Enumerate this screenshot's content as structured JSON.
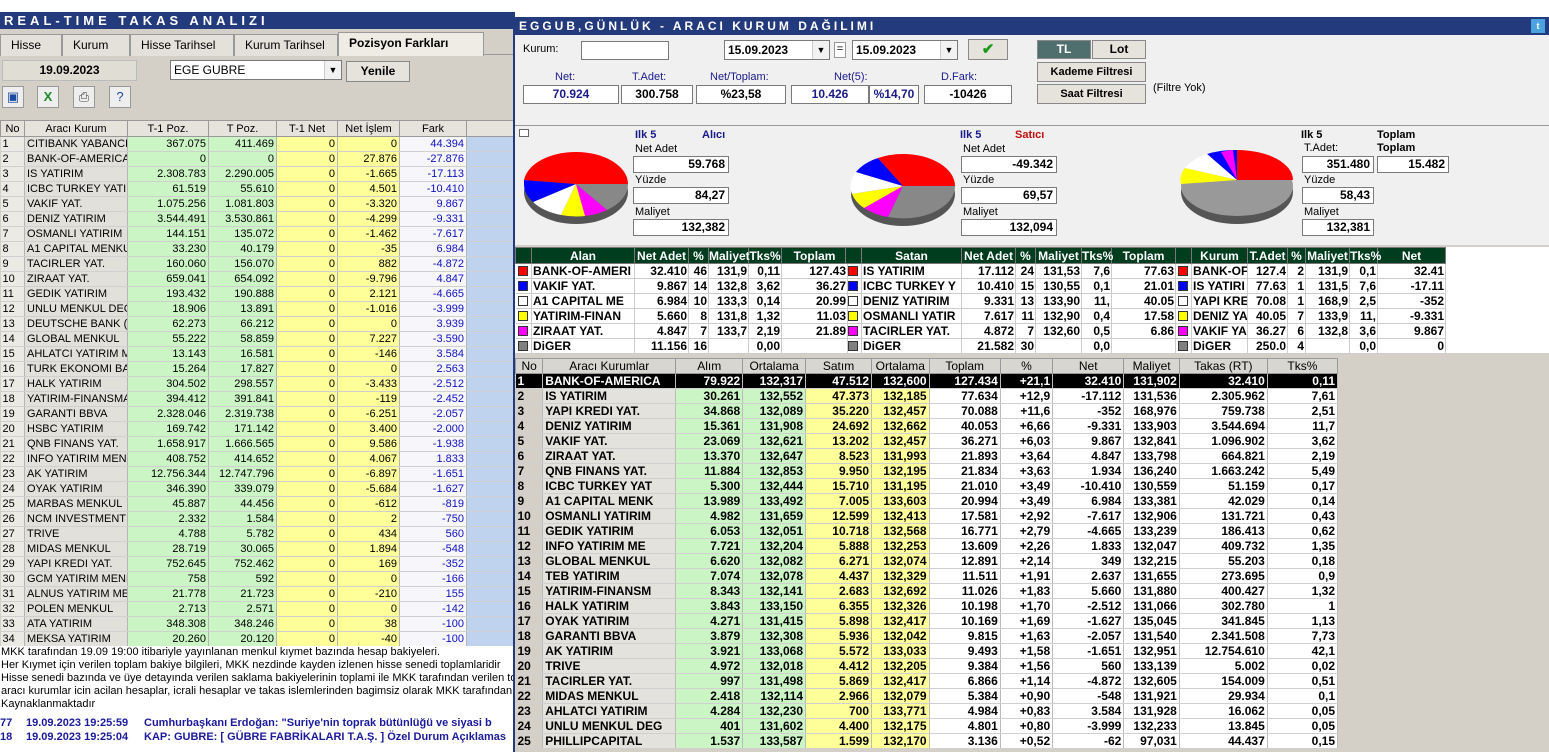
{
  "left": {
    "title": "REAL-TIME TAKAS ANALIZI",
    "tabs": [
      "Hisse",
      "Kurum",
      "Hisse Tarihsel",
      "Kurum Tarihsel",
      "Pozisyon Farkları"
    ],
    "date": "19.09.2023",
    "stock": "EGE GUBRE",
    "refresh": "Yenile",
    "columns": [
      "No",
      "Aracı Kurum",
      "T-1 Poz.",
      "T Poz.",
      "T-1 Net",
      "Net İşlem",
      "Fark"
    ],
    "rows": [
      [
        "1",
        "CITIBANK YABANCI",
        "367.075",
        "411.469",
        "0",
        "0",
        "44.394"
      ],
      [
        "2",
        "BANK-OF-AMERICA",
        "0",
        "0",
        "0",
        "27.876",
        "-27.876"
      ],
      [
        "3",
        "IS YATIRIM",
        "2.308.783",
        "2.290.005",
        "0",
        "-1.665",
        "-17.113"
      ],
      [
        "4",
        "ICBC TURKEY YATIR",
        "61.519",
        "55.610",
        "0",
        "4.501",
        "-10.410"
      ],
      [
        "5",
        "VAKIF YAT.",
        "1.075.256",
        "1.081.803",
        "0",
        "-3.320",
        "9.867"
      ],
      [
        "6",
        "DENIZ YATIRIM",
        "3.544.491",
        "3.530.861",
        "0",
        "-4.299",
        "-9.331"
      ],
      [
        "7",
        "OSMANLI YATIRIM",
        "144.151",
        "135.072",
        "0",
        "-1.462",
        "-7.617"
      ],
      [
        "8",
        "A1 CAPITAL MENKU",
        "33.230",
        "40.179",
        "0",
        "-35",
        "6.984"
      ],
      [
        "9",
        "TACIRLER YAT.",
        "160.060",
        "156.070",
        "0",
        "882",
        "-4.872"
      ],
      [
        "10",
        "ZIRAAT YAT.",
        "659.041",
        "654.092",
        "0",
        "-9.796",
        "4.847"
      ],
      [
        "11",
        "GEDIK YATIRIM",
        "193.432",
        "190.888",
        "0",
        "2.121",
        "-4.665"
      ],
      [
        "12",
        "UNLU MENKUL DEGE",
        "18.906",
        "13.891",
        "0",
        "-1.016",
        "-3.999"
      ],
      [
        "13",
        "DEUTSCHE BANK (Y",
        "62.273",
        "66.212",
        "0",
        "0",
        "3.939"
      ],
      [
        "14",
        "GLOBAL MENKUL",
        "55.222",
        "58.859",
        "0",
        "7.227",
        "-3.590"
      ],
      [
        "15",
        "AHLATCI YATIRIM M",
        "13.143",
        "16.581",
        "0",
        "-146",
        "3.584"
      ],
      [
        "16",
        "TURK EKONOMI BAN",
        "15.264",
        "17.827",
        "0",
        "0",
        "2.563"
      ],
      [
        "17",
        "HALK YATIRIM",
        "304.502",
        "298.557",
        "0",
        "-3.433",
        "-2.512"
      ],
      [
        "18",
        "YATIRIM-FINANSMA",
        "394.412",
        "391.841",
        "0",
        "-119",
        "-2.452"
      ],
      [
        "19",
        "GARANTI BBVA",
        "2.328.046",
        "2.319.738",
        "0",
        "-6.251",
        "-2.057"
      ],
      [
        "20",
        "HSBC YATIRIM",
        "169.742",
        "171.142",
        "0",
        "3.400",
        "-2.000"
      ],
      [
        "21",
        "QNB FINANS YAT.",
        "1.658.917",
        "1.666.565",
        "0",
        "9.586",
        "-1.938"
      ],
      [
        "22",
        "INFO YATIRIM MEN",
        "408.752",
        "414.652",
        "0",
        "4.067",
        "1.833"
      ],
      [
        "23",
        "AK YATIRIM",
        "12.756.344",
        "12.747.796",
        "0",
        "-6.897",
        "-1.651"
      ],
      [
        "24",
        "OYAK YATIRIM",
        "346.390",
        "339.079",
        "0",
        "-5.684",
        "-1.627"
      ],
      [
        "25",
        "MARBAS MENKUL",
        "45.887",
        "44.456",
        "0",
        "-612",
        "-819"
      ],
      [
        "26",
        "NCM INVESTMENT",
        "2.332",
        "1.584",
        "0",
        "2",
        "-750"
      ],
      [
        "27",
        "TRIVE",
        "4.788",
        "5.782",
        "0",
        "434",
        "560"
      ],
      [
        "28",
        "MIDAS MENKUL",
        "28.719",
        "30.065",
        "0",
        "1.894",
        "-548"
      ],
      [
        "29",
        "YAPI KREDI YAT.",
        "752.645",
        "752.462",
        "0",
        "169",
        "-352"
      ],
      [
        "30",
        "GCM YATIRIM MENK",
        "758",
        "592",
        "0",
        "0",
        "-166"
      ],
      [
        "31",
        "ALNUS YATIRIM ME",
        "21.778",
        "21.723",
        "0",
        "-210",
        "155"
      ],
      [
        "32",
        "POLEN MENKUL",
        "2.713",
        "2.571",
        "0",
        "0",
        "-142"
      ],
      [
        "33",
        "ATA YATIRIM",
        "348.308",
        "348.246",
        "0",
        "38",
        "-100"
      ],
      [
        "34",
        "MEKSA YATIRIM",
        "20.260",
        "20.120",
        "0",
        "-40",
        "-100"
      ]
    ],
    "notes": [
      "MKK tarafından 19.09 19:00 itibariyle yayınlanan menkul kıymet bazında hesap bakiyeleri.",
      "Her Kıymet için verilen toplam bakiye bilgileri, MKK nezdinde kayden izlenen hisse senedi toplamlaridir",
      "Hisse senedi bazında ve üye detayında verilen saklama bakiyelerinin toplami ile MKK tarafından verilen toplan",
      "aracı kurumlar icin acilan hesaplar, icrali hesaplar ve takas islemlerinden bagimsiz olarak MKK tarafından kulla",
      "Kaynaklanmaktadır"
    ],
    "news": [
      [
        "77",
        "19.09.2023 19:25:59",
        "Cumhurbaşkanı Erdoğan: \"Suriye'nin toprak bütünlüğü ve siyasi b"
      ],
      [
        "18",
        "19.09.2023 19:25:04",
        "KAP: GUBRE: [ GÜBRE FABRİKALARI T.A.Ş. ] Özel Durum Açıklamas"
      ]
    ]
  },
  "right": {
    "title": "EGGUB,GÜNLÜK - ARACI KURUM DAĞILIMI",
    "kurum_label": "Kurum:",
    "date_from": "15.09.2023",
    "equals": "=",
    "date_to": "15.09.2023",
    "tl": "TL",
    "lot": "Lot",
    "kademe": "Kademe Filtresi",
    "saat": "Saat Filtresi",
    "filtre_yok": "(Filtre Yok)",
    "stats_labels": [
      "Net:",
      "T.Adet:",
      "Net/Toplam:",
      "Net(5):",
      "D.Fark:"
    ],
    "stats": [
      "70.924",
      "300.758",
      "%23,58",
      "10.426",
      "%14,70",
      "-10426"
    ],
    "pie1": {
      "title": "Ilk 5",
      "side": "Alıcı",
      "net_label": "Net Adet",
      "net": "59.768",
      "yuzde_label": "Yüzde",
      "yuzde": "84,27",
      "maliyet_label": "Maliyet",
      "maliyet": "132,382"
    },
    "pie2": {
      "title": "Ilk 5",
      "side": "Satıcı",
      "net_label": "Net Adet",
      "net": "-49.342",
      "yuzde_label": "Yüzde",
      "yuzde": "69,57",
      "maliyet_label": "Maliyet",
      "maliyet": "132,094"
    },
    "pie3": {
      "title": "Ilk 5",
      "toplam1": "Toplam",
      "tadet_label": "T.Adet:",
      "toplam2": "Toplam",
      "tadet": "351.480",
      "toplam": "15.482",
      "yuzde_label": "Yüzde",
      "yuzde": "58,43",
      "maliyet_label": "Maliyet",
      "maliyet": "132,381"
    },
    "alan_cols": [
      "Alan",
      "Net Adet",
      "%",
      "Maliyet",
      "Tks%",
      "Toplam"
    ],
    "alan": [
      [
        "#ff0000",
        "BANK-OF-AMERI",
        "32.410",
        "46",
        "131,9",
        "0,11",
        "127.43"
      ],
      [
        "#0000ff",
        "VAKIF YAT.",
        "9.867",
        "14",
        "132,8",
        "3,62",
        "36.27"
      ],
      [
        "#ffffff",
        "A1 CAPITAL ME",
        "6.984",
        "10",
        "133,3",
        "0,14",
        "20.99"
      ],
      [
        "#ffff00",
        "YATIRIM-FINAN",
        "5.660",
        "8",
        "131,8",
        "1,32",
        "11.03"
      ],
      [
        "#ff00ff",
        "ZIRAAT YAT.",
        "4.847",
        "7",
        "133,7",
        "2,19",
        "21.89"
      ],
      [
        "#808080",
        "DiGER",
        "11.156",
        "16",
        "",
        "0,00",
        ""
      ]
    ],
    "satan_cols": [
      "Satan",
      "Net Adet",
      "%",
      "Maliyet",
      "Tks%",
      "Toplam"
    ],
    "satan": [
      [
        "#ff0000",
        "IS YATIRIM",
        "17.112",
        "24",
        "131,53",
        "7,6",
        "77.63"
      ],
      [
        "#0000ff",
        "ICBC TURKEY Y",
        "10.410",
        "15",
        "130,55",
        "0,1",
        "21.01"
      ],
      [
        "#ffffff",
        "DENIZ YATIRIM",
        "9.331",
        "13",
        "133,90",
        "11,",
        "40.05"
      ],
      [
        "#ffff00",
        "OSMANLI YATIR",
        "7.617",
        "11",
        "132,90",
        "0,4",
        "17.58"
      ],
      [
        "#ff00ff",
        "TACIRLER YAT.",
        "4.872",
        "7",
        "132,60",
        "0,5",
        "6.86"
      ],
      [
        "#808080",
        "DiGER",
        "21.582",
        "30",
        "",
        "0,0",
        ""
      ]
    ],
    "kurum_cols": [
      "Kurum",
      "T.Adet",
      "%",
      "Maliyet",
      "Tks%",
      "Net"
    ],
    "kurum": [
      [
        "#ff0000",
        "BANK-OF-",
        "127.4",
        "2",
        "131,9",
        "0,1",
        "32.41"
      ],
      [
        "#0000ff",
        "IS YATIRI",
        "77.63",
        "1",
        "131,5",
        "7,6",
        "-17.11"
      ],
      [
        "#ffffff",
        "YAPI KRE",
        "70.08",
        "1",
        "168,9",
        "2,5",
        "-352"
      ],
      [
        "#ffff00",
        "DENIZ YA",
        "40.05",
        "7",
        "133,9",
        "11,",
        "-9.331"
      ],
      [
        "#ff00ff",
        "VAKIF YA",
        "36.27",
        "6",
        "132,8",
        "3,6",
        "9.867"
      ],
      [
        "#808080",
        "DiGER",
        "250.0",
        "4",
        "",
        "0,0",
        "0"
      ]
    ],
    "big_cols": [
      "No",
      "Aracı Kurumlar",
      "Alım",
      "Ortalama",
      "Satım",
      "Ortalama",
      "Toplam",
      "%",
      "Net",
      "Maliyet",
      "Takas (RT)",
      "Tks%"
    ],
    "big": [
      [
        "1",
        "BANK-OF-AMERICA",
        "79.922",
        "132,317",
        "47.512",
        "132,600",
        "127.434",
        "+21,1",
        "32.410",
        "131,902",
        "32.410",
        "0,11"
      ],
      [
        "2",
        "IS YATIRIM",
        "30.261",
        "132,552",
        "47.373",
        "132,185",
        "77.634",
        "+12,9",
        "-17.112",
        "131,536",
        "2.305.962",
        "7,61"
      ],
      [
        "3",
        "YAPI KREDI YAT.",
        "34.868",
        "132,089",
        "35.220",
        "132,457",
        "70.088",
        "+11,6",
        "-352",
        "168,976",
        "759.738",
        "2,51"
      ],
      [
        "4",
        "DENIZ YATIRIM",
        "15.361",
        "131,908",
        "24.692",
        "132,662",
        "40.053",
        "+6,66",
        "-9.331",
        "133,903",
        "3.544.694",
        "11,7"
      ],
      [
        "5",
        "VAKIF YAT.",
        "23.069",
        "132,621",
        "13.202",
        "132,457",
        "36.271",
        "+6,03",
        "9.867",
        "132,841",
        "1.096.902",
        "3,62"
      ],
      [
        "6",
        "ZIRAAT YAT.",
        "13.370",
        "132,647",
        "8.523",
        "131,993",
        "21.893",
        "+3,64",
        "4.847",
        "133,798",
        "664.821",
        "2,19"
      ],
      [
        "7",
        "QNB FINANS YAT.",
        "11.884",
        "132,853",
        "9.950",
        "132,195",
        "21.834",
        "+3,63",
        "1.934",
        "136,240",
        "1.663.242",
        "5,49"
      ],
      [
        "8",
        "ICBC TURKEY YAT",
        "5.300",
        "132,444",
        "15.710",
        "131,195",
        "21.010",
        "+3,49",
        "-10.410",
        "130,559",
        "51.159",
        "0,17"
      ],
      [
        "9",
        "A1 CAPITAL MENK",
        "13.989",
        "133,492",
        "7.005",
        "133,603",
        "20.994",
        "+3,49",
        "6.984",
        "133,381",
        "42.029",
        "0,14"
      ],
      [
        "10",
        "OSMANLI YATIRIM",
        "4.982",
        "131,659",
        "12.599",
        "132,413",
        "17.581",
        "+2,92",
        "-7.617",
        "132,906",
        "131.721",
        "0,43"
      ],
      [
        "11",
        "GEDIK YATIRIM",
        "6.053",
        "132,051",
        "10.718",
        "132,568",
        "16.771",
        "+2,79",
        "-4.665",
        "133,239",
        "186.413",
        "0,62"
      ],
      [
        "12",
        "INFO YATIRIM ME",
        "7.721",
        "132,204",
        "5.888",
        "132,253",
        "13.609",
        "+2,26",
        "1.833",
        "132,047",
        "409.732",
        "1,35"
      ],
      [
        "13",
        "GLOBAL MENKUL",
        "6.620",
        "132,082",
        "6.271",
        "132,074",
        "12.891",
        "+2,14",
        "349",
        "132,215",
        "55.203",
        "0,18"
      ],
      [
        "14",
        "TEB YATIRIM",
        "7.074",
        "132,078",
        "4.437",
        "132,329",
        "11.511",
        "+1,91",
        "2.637",
        "131,655",
        "273.695",
        "0,9"
      ],
      [
        "15",
        "YATIRIM-FINANSM",
        "8.343",
        "132,141",
        "2.683",
        "132,692",
        "11.026",
        "+1,83",
        "5.660",
        "131,880",
        "400.427",
        "1,32"
      ],
      [
        "16",
        "HALK YATIRIM",
        "3.843",
        "133,150",
        "6.355",
        "132,326",
        "10.198",
        "+1,70",
        "-2.512",
        "131,066",
        "302.780",
        "1"
      ],
      [
        "17",
        "OYAK YATIRIM",
        "4.271",
        "131,415",
        "5.898",
        "132,417",
        "10.169",
        "+1,69",
        "-1.627",
        "135,045",
        "341.845",
        "1,13"
      ],
      [
        "18",
        "GARANTI BBVA",
        "3.879",
        "132,308",
        "5.936",
        "132,042",
        "9.815",
        "+1,63",
        "-2.057",
        "131,540",
        "2.341.508",
        "7,73"
      ],
      [
        "19",
        "AK YATIRIM",
        "3.921",
        "133,068",
        "5.572",
        "133,033",
        "9.493",
        "+1,58",
        "-1.651",
        "132,951",
        "12.754.610",
        "42,1"
      ],
      [
        "20",
        "TRIVE",
        "4.972",
        "132,018",
        "4.412",
        "132,205",
        "9.384",
        "+1,56",
        "560",
        "133,139",
        "5.002",
        "0,02"
      ],
      [
        "21",
        "TACIRLER YAT.",
        "997",
        "131,498",
        "5.869",
        "132,417",
        "6.866",
        "+1,14",
        "-4.872",
        "132,605",
        "154.009",
        "0,51"
      ],
      [
        "22",
        "MIDAS MENKUL",
        "2.418",
        "132,114",
        "2.966",
        "132,079",
        "5.384",
        "+0,90",
        "-548",
        "131,921",
        "29.934",
        "0,1"
      ],
      [
        "23",
        "AHLATCI YATIRIM",
        "4.284",
        "132,230",
        "700",
        "133,771",
        "4.984",
        "+0,83",
        "3.584",
        "131,928",
        "16.062",
        "0,05"
      ],
      [
        "24",
        "UNLU MENKUL DEG",
        "401",
        "131,602",
        "4.400",
        "132,175",
        "4.801",
        "+0,80",
        "-3.999",
        "132,233",
        "13.845",
        "0,05"
      ],
      [
        "25",
        "PHILLIPCAPITAL",
        "1.537",
        "133,587",
        "1.599",
        "132,170",
        "3.136",
        "+0,52",
        "-62",
        "97,031",
        "44.437",
        "0,15"
      ]
    ]
  }
}
